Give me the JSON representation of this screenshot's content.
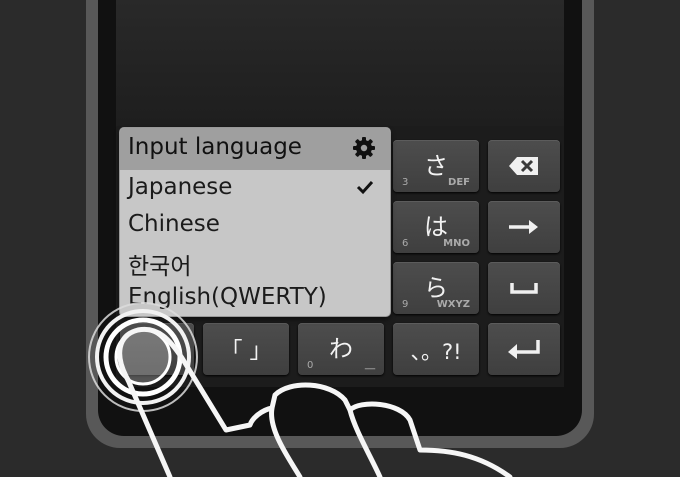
{
  "popup": {
    "title": "Input language",
    "selected": "Japanese",
    "languages": [
      "Japanese",
      "Chinese",
      "한국어",
      "English(QWERTY)"
    ]
  },
  "keys": {
    "sa": {
      "kana": "さ",
      "num": "3",
      "letters": "DEF"
    },
    "ha": {
      "kana": "は",
      "num": "6",
      "letters": "MNO"
    },
    "ra": {
      "kana": "ら",
      "num": "9",
      "letters": "WXYZ"
    },
    "wa": {
      "kana": "わ",
      "num": "0",
      "letters": "＿"
    },
    "brackets": "「 」",
    "punct": "、。?!"
  },
  "icons": {
    "settings": "gear-icon",
    "check": "checkmark-icon",
    "backspace": "backspace-icon",
    "right": "arrow-right-icon",
    "space": "space-icon",
    "enter": "enter-icon",
    "touch": "finger-tap-icon"
  },
  "colors": {
    "background": "#2b2b2b",
    "key": "#474747",
    "popup": "#c7c7c7",
    "popup_header": "#9f9f9f"
  }
}
